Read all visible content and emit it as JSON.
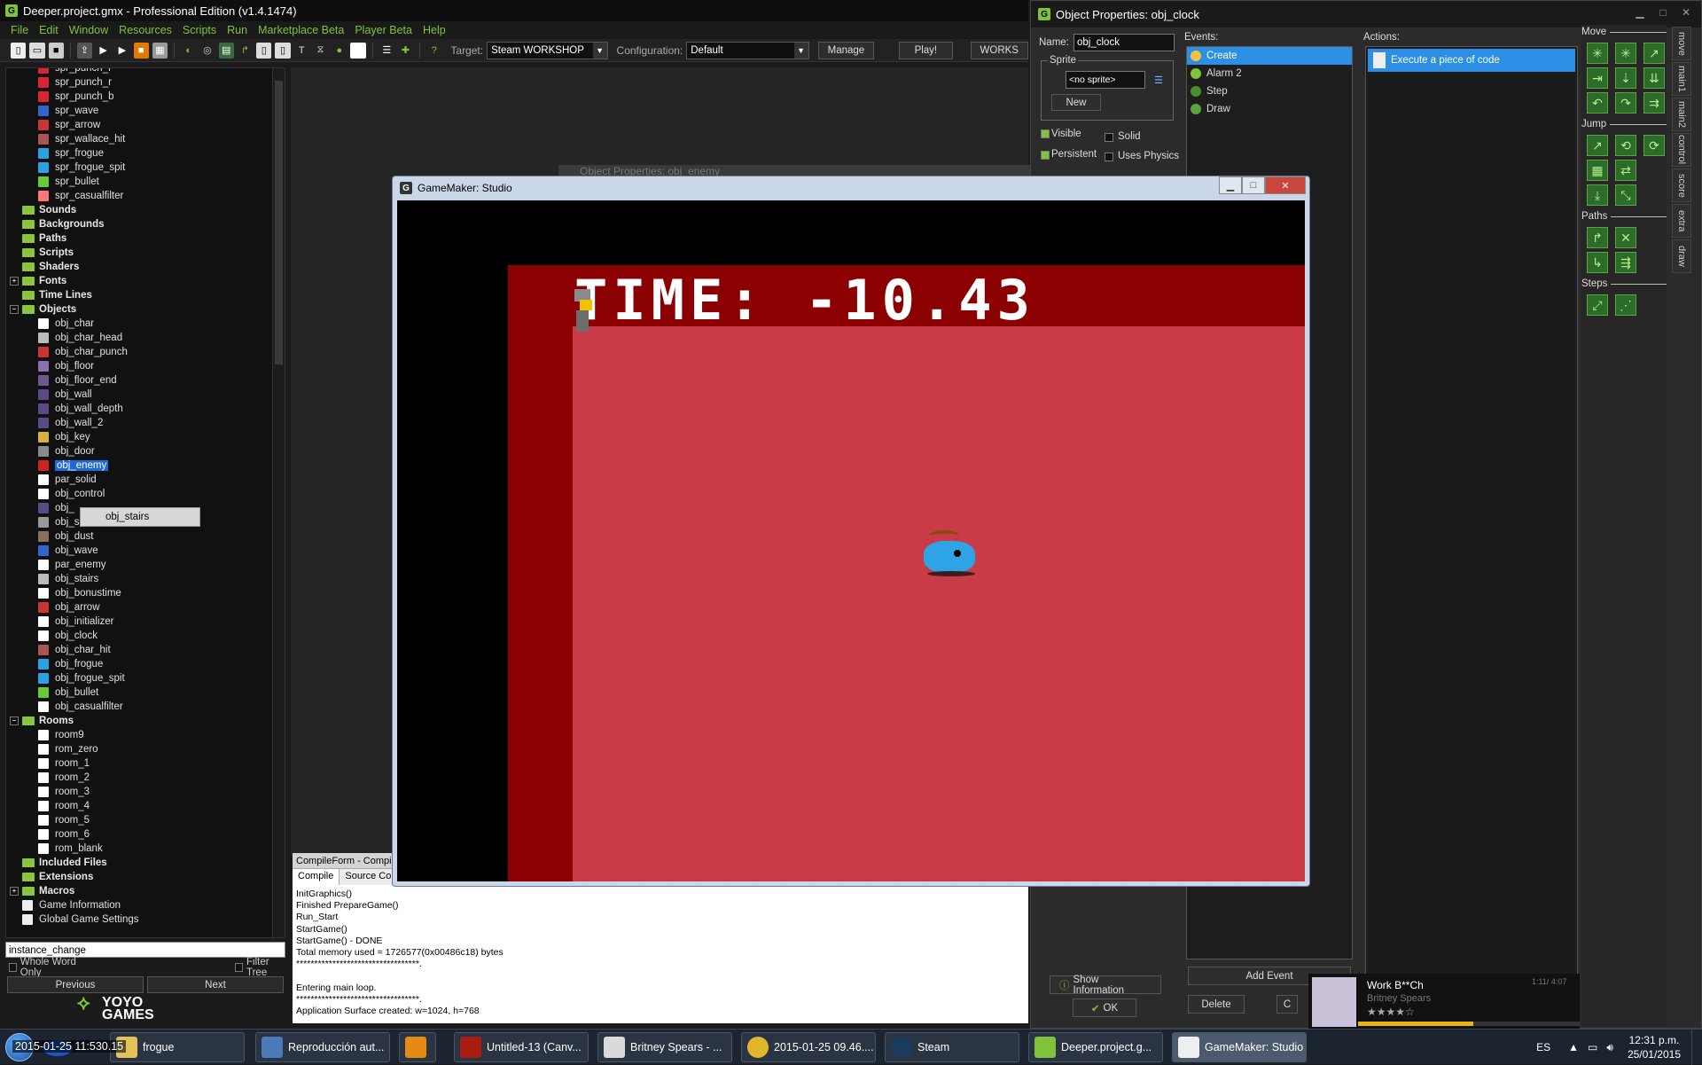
{
  "ide": {
    "title": "Deeper.project.gmx  -  Professional Edition (v1.4.1474)",
    "menu": [
      "File",
      "Edit",
      "Window",
      "Resources",
      "Scripts",
      "Run",
      "Marketplace Beta",
      "Player Beta",
      "Help"
    ],
    "target_label": "Target:",
    "target_value": "Steam WORKSHOP",
    "config_label": "Configuration:",
    "config_value": "Default",
    "manage_label": "Manage",
    "play_label": "Play!",
    "workshop_label": "WORKS"
  },
  "tree": {
    "sprites": [
      "spr_punch_l",
      "spr_punch_r",
      "spr_punch_b",
      "spr_wave",
      "spr_arrow",
      "spr_wallace_hit",
      "spr_frogue",
      "spr_frogue_spit",
      "spr_bullet",
      "spr_casualfilter"
    ],
    "folders_a": [
      "Sounds",
      "Backgrounds",
      "Paths",
      "Scripts",
      "Shaders",
      "Fonts",
      "Time Lines",
      "Objects"
    ],
    "objects": [
      "obj_char",
      "obj_char_head",
      "obj_char_punch",
      "obj_floor",
      "obj_floor_end",
      "obj_wall",
      "obj_wall_depth",
      "obj_wall_2",
      "obj_key",
      "obj_door",
      "obj_enemy",
      "par_solid",
      "obj_control",
      "obj_",
      "obj_skull",
      "obj_dust",
      "obj_wave",
      "par_enemy",
      "obj_stairs",
      "obj_bonustime",
      "obj_arrow",
      "obj_initializer",
      "obj_clock",
      "obj_char_hit",
      "obj_frogue",
      "obj_frogue_spit",
      "obj_bullet",
      "obj_casualfilter"
    ],
    "rooms_folder": "Rooms",
    "rooms": [
      "room9",
      "rom_zero",
      "room_1",
      "room_2",
      "room_3",
      "room_4",
      "room_5",
      "room_6",
      "rom_blank"
    ],
    "folders_b": [
      "Included Files",
      "Extensions",
      "Macros"
    ],
    "extras": [
      "Game Information",
      "Global Game Settings"
    ],
    "tooltip": "obj_stairs"
  },
  "search": {
    "value": "instance_change",
    "whole_word": "Whole Word Only",
    "filter_tree": "Filter Tree",
    "previous": "Previous",
    "next": "Next"
  },
  "logo": {
    "line1": "YOYO",
    "line2": "GAMES"
  },
  "compile": {
    "title": "CompileForm - Compile",
    "tabs": [
      "Compile",
      "Source Con"
    ],
    "log": "InitGraphics()\nFinished PrepareGame()\nRun_Start\nStartGame()\nStartGame() - DONE\nTotal memory used = 1726577(0x00486c18) bytes\n**********************************.\n\nEntering main loop.\n**********************************.\nApplication Surface created: w=1024, h=768"
  },
  "object_props": {
    "title": "Object Properties: obj_clock",
    "name_label": "Name:",
    "name_value": "obj_clock",
    "sprite_label": "Sprite",
    "sprite_value": "<no sprite>",
    "new_label": "New",
    "visible": "Visible",
    "solid": "Solid",
    "persistent": "Persistent",
    "uses_physics": "Uses Physics",
    "events_label": "Events:",
    "events": [
      "Create",
      "Alarm 2",
      "Step",
      "Draw"
    ],
    "actions_label": "Actions:",
    "action": "Execute a piece of code",
    "show_info": "Show Information",
    "ok": "OK",
    "add_event": "Add Event",
    "delete": "Delete",
    "change": "C"
  },
  "library": {
    "sections": [
      "Move",
      "Jump",
      "Paths",
      "Steps"
    ],
    "tabs": [
      "move",
      "main1",
      "main2",
      "control",
      "score",
      "extra",
      "draw"
    ]
  },
  "behind_window": "Object Properties: obj_enemy",
  "game": {
    "title": "GameMaker: Studio",
    "hud": "TIME: -10.43"
  },
  "media": {
    "track": "Work B**Ch",
    "artist": "Britney Spears",
    "time": "1:11/ 4:07"
  },
  "taskbar": {
    "items": [
      "frogue",
      "Reproducción aut...",
      "",
      "Untitled-13 (Canv...",
      "Britney Spears - ...",
      "2015-01-25 09.46....",
      "Steam",
      "Deeper.project.g...",
      "GameMaker: Studio"
    ],
    "overlay": "2015-01-25 11:530.15",
    "lang": "ES",
    "clock_time": "12:31 p.m.",
    "clock_date": "25/01/2015"
  }
}
